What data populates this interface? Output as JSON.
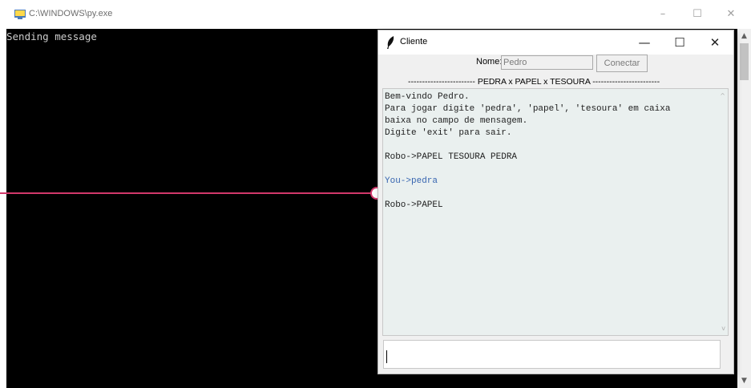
{
  "console": {
    "title": "C:\\WINDOWS\\py.exe",
    "icon": "python-terminal-icon",
    "output": "Sending message",
    "controls": {
      "minimize": "–",
      "maximize": "☐",
      "close": "✕"
    },
    "scroll_up": "▲",
    "scroll_down": "▼"
  },
  "client": {
    "title": "Cliente",
    "icon": "tk-feather-icon",
    "controls": {
      "minimize": "—",
      "maximize": "☐",
      "close": "✕"
    },
    "name_label": "Nome:",
    "name_value": "Pedro",
    "connect_label": "Conectar",
    "heading": "------------------------ PEDRA x PAPEL x TESOURA ------------------------",
    "messages": [
      "Bem-vindo Pedro.",
      "Para jogar digite 'pedra', 'papel', 'tesoura' em caixa",
      "baixa no campo de mensagem.",
      "Digite 'exit' para sair.",
      "",
      "Robo->PAPEL TESOURA PEDRA",
      "",
      "You->pedra",
      "",
      "Robo->PAPEL"
    ],
    "message_input_value": "",
    "scroll_up": "^",
    "scroll_down": "v"
  },
  "colors": {
    "console_bg": "#000000",
    "console_text": "#cccccc",
    "message_bg": "#eaf0ef",
    "you_text": "#3765b0",
    "pointer": "#d2386b"
  }
}
